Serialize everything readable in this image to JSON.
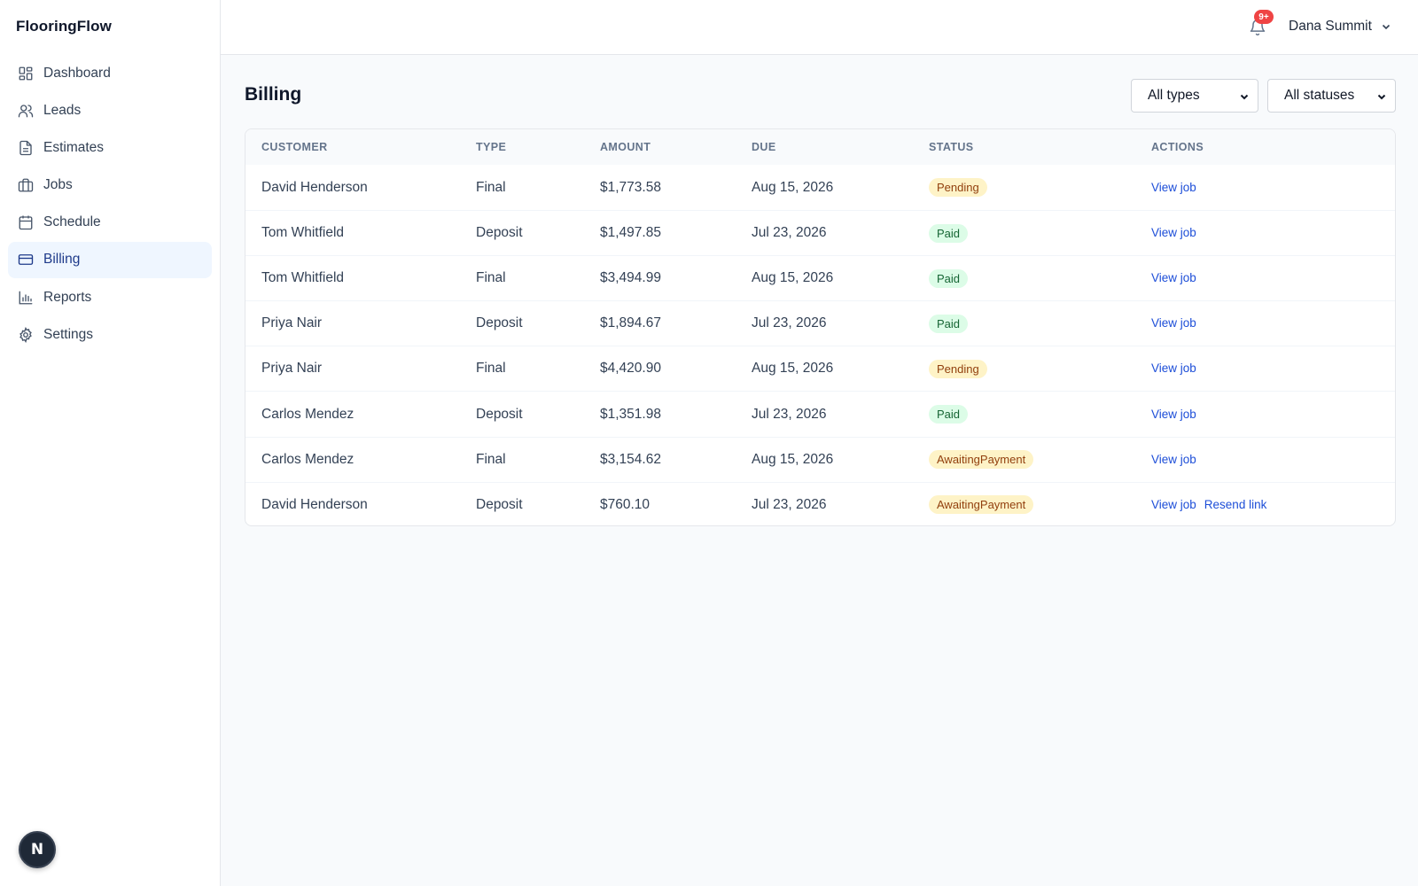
{
  "app": {
    "brand": "FlooringFlow"
  },
  "sidebar": {
    "items": [
      {
        "label": "Dashboard",
        "icon": "dashboard-icon",
        "active": false
      },
      {
        "label": "Leads",
        "icon": "users-icon",
        "active": false
      },
      {
        "label": "Estimates",
        "icon": "document-icon",
        "active": false
      },
      {
        "label": "Jobs",
        "icon": "briefcase-icon",
        "active": false
      },
      {
        "label": "Schedule",
        "icon": "calendar-icon",
        "active": false
      },
      {
        "label": "Billing",
        "icon": "credit-card-icon",
        "active": true
      },
      {
        "label": "Reports",
        "icon": "bar-chart-icon",
        "active": false
      },
      {
        "label": "Settings",
        "icon": "gear-icon",
        "active": false
      }
    ],
    "n_badge": "N"
  },
  "header": {
    "notifications_count": "9+",
    "user_name": "Dana Summit"
  },
  "page": {
    "title": "Billing",
    "filters": {
      "type": "All types",
      "status": "All statuses"
    }
  },
  "table": {
    "columns": [
      "CUSTOMER",
      "TYPE",
      "AMOUNT",
      "DUE",
      "STATUS",
      "ACTIONS"
    ],
    "rows": [
      {
        "customer": "David Henderson",
        "type": "Final",
        "amount": "$1,773.58",
        "due": "Aug 15, 2026",
        "status": "Pending",
        "status_kind": "pending",
        "actions": [
          "View job"
        ]
      },
      {
        "customer": "Tom Whitfield",
        "type": "Deposit",
        "amount": "$1,497.85",
        "due": "Jul 23, 2026",
        "status": "Paid",
        "status_kind": "paid",
        "actions": [
          "View job"
        ]
      },
      {
        "customer": "Tom Whitfield",
        "type": "Final",
        "amount": "$3,494.99",
        "due": "Aug 15, 2026",
        "status": "Paid",
        "status_kind": "paid",
        "actions": [
          "View job"
        ]
      },
      {
        "customer": "Priya Nair",
        "type": "Deposit",
        "amount": "$1,894.67",
        "due": "Jul 23, 2026",
        "status": "Paid",
        "status_kind": "paid",
        "actions": [
          "View job"
        ]
      },
      {
        "customer": "Priya Nair",
        "type": "Final",
        "amount": "$4,420.90",
        "due": "Aug 15, 2026",
        "status": "Pending",
        "status_kind": "pending",
        "actions": [
          "View job"
        ]
      },
      {
        "customer": "Carlos Mendez",
        "type": "Deposit",
        "amount": "$1,351.98",
        "due": "Jul 23, 2026",
        "status": "Paid",
        "status_kind": "paid",
        "actions": [
          "View job"
        ]
      },
      {
        "customer": "Carlos Mendez",
        "type": "Final",
        "amount": "$3,154.62",
        "due": "Aug 15, 2026",
        "status": "AwaitingPayment",
        "status_kind": "awaiting",
        "actions": [
          "View job"
        ]
      },
      {
        "customer": "David Henderson",
        "type": "Deposit",
        "amount": "$760.10",
        "due": "Jul 23, 2026",
        "status": "AwaitingPayment",
        "status_kind": "awaiting",
        "actions": [
          "View job",
          "Resend link"
        ]
      }
    ]
  },
  "colors": {
    "accent": "#1d4ed8",
    "active_nav_bg": "#eff6ff",
    "pending_bg": "#fef3c7",
    "paid_bg": "#dcfce7",
    "badge_red": "#ef4444"
  }
}
